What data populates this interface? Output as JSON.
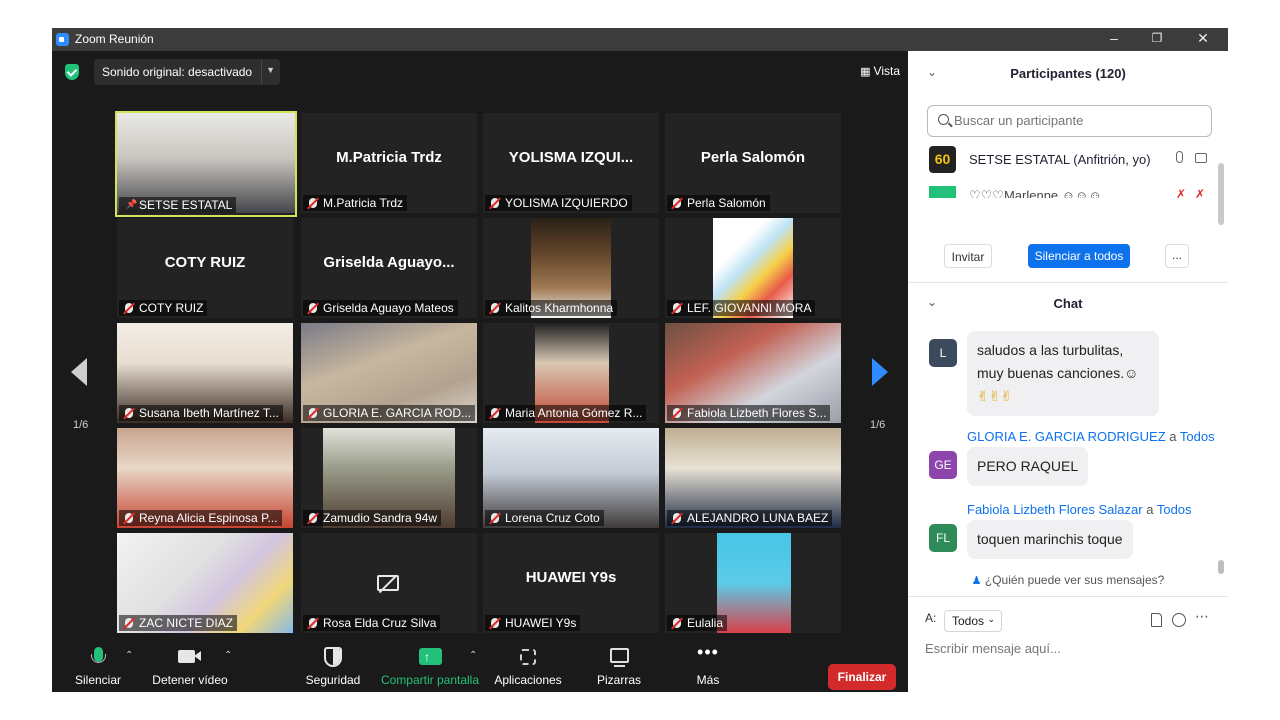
{
  "window": {
    "title": "Zoom Reunión"
  },
  "meeting": {
    "sound_original": "Sonido original: desactivado",
    "view_label": "Vista",
    "page_left": "1/6",
    "page_right": "1/6",
    "tiles": [
      {
        "name": "SETSE ESTATAL",
        "big": "",
        "video": true,
        "active": true,
        "pinned": true
      },
      {
        "name": "M.Patricia Trdz",
        "big": "M.Patricia Trdz"
      },
      {
        "name": "YOLISMA IZQUIERDO",
        "big": "YOLISMA  IZQUI..."
      },
      {
        "name": "Perla Salomón",
        "big": "Perla Salomón"
      },
      {
        "name": "COTY RUIZ",
        "big": "COTY RUIZ"
      },
      {
        "name": "Griselda Aguayo Mateos",
        "big": "Griselda  Aguayo..."
      },
      {
        "name": "Kalitos Kharmhonna",
        "big": "",
        "video": true
      },
      {
        "name": "LEF. GIOVANNI MORA",
        "big": "",
        "video": true
      },
      {
        "name": "Susana Ibeth Martínez T...",
        "big": "",
        "video": true
      },
      {
        "name": "GLORIA E. GARCIA ROD...",
        "big": "",
        "video": true
      },
      {
        "name": "Maria Antonia Gómez R...",
        "big": "",
        "video": true
      },
      {
        "name": "Fabiola Lizbeth Flores S...",
        "big": "",
        "video": true
      },
      {
        "name": "Reyna Alicia Espinosa P...",
        "big": "",
        "video": true
      },
      {
        "name": "Zamudio Sandra 94w",
        "big": "",
        "video": true
      },
      {
        "name": "Lorena Cruz Coto",
        "big": "",
        "video": true
      },
      {
        "name": "ALEJANDRO LUNA BAEZ",
        "big": "",
        "video": true
      },
      {
        "name": "ZAC NICTE DIAZ",
        "big": "",
        "video": true
      },
      {
        "name": "Rosa Elda Cruz Silva",
        "big": "",
        "camera_off": true
      },
      {
        "name": "HUAWEI Y9s",
        "big": "HUAWEI Y9s"
      },
      {
        "name": "Eulalia",
        "big": "",
        "video": true
      }
    ]
  },
  "toolbar": {
    "mute": "Silenciar",
    "stop_video": "Detener vídeo",
    "security": "Seguridad",
    "share": "Compartir pantalla",
    "apps": "Aplicaciones",
    "whiteboards": "Pizarras",
    "more": "Más",
    "end": "Finalizar"
  },
  "participants": {
    "header": "Participantes (120)",
    "search_placeholder": "Buscar un participante",
    "list": [
      {
        "name": "SETSE ESTATAL (Anfitrión, yo)",
        "avatar": "60"
      },
      {
        "name": "♡♡♡Marlenne ☺☺☺",
        "avatar": ""
      }
    ],
    "invite": "Invitar",
    "mute_all": "Silenciar a todos",
    "more": "..."
  },
  "chat": {
    "header": "Chat",
    "messages": [
      {
        "avatar": "L",
        "color": "#3c4a5e",
        "sender": "",
        "to": "",
        "text_line1": "saludos a las turbulitas,",
        "text_line2": "muy buenas canciones.☺",
        "text_line3": "✌✌✌"
      },
      {
        "avatar": "GE",
        "color": "#8e44ad",
        "sender": "GLORIA E. GARCIA RODRIGUEZ",
        "to_word": "a",
        "to": "Todos",
        "text": "PERO RAQUEL"
      },
      {
        "avatar": "FL",
        "color": "#2e8b57",
        "sender": "Fabiola Lizbeth Flores Salazar",
        "to_word": "a",
        "to": "Todos",
        "text": "toquen marinchis toque"
      }
    ],
    "who_can_see": "¿Quién puede ver sus mensajes?",
    "to_label": "A:",
    "to_value": "Todos",
    "composer_placeholder": "Escribir mensaje aquí..."
  },
  "colors": {
    "accent": "#0e72ed",
    "end": "#d32b2b",
    "share": "#23c07a"
  }
}
